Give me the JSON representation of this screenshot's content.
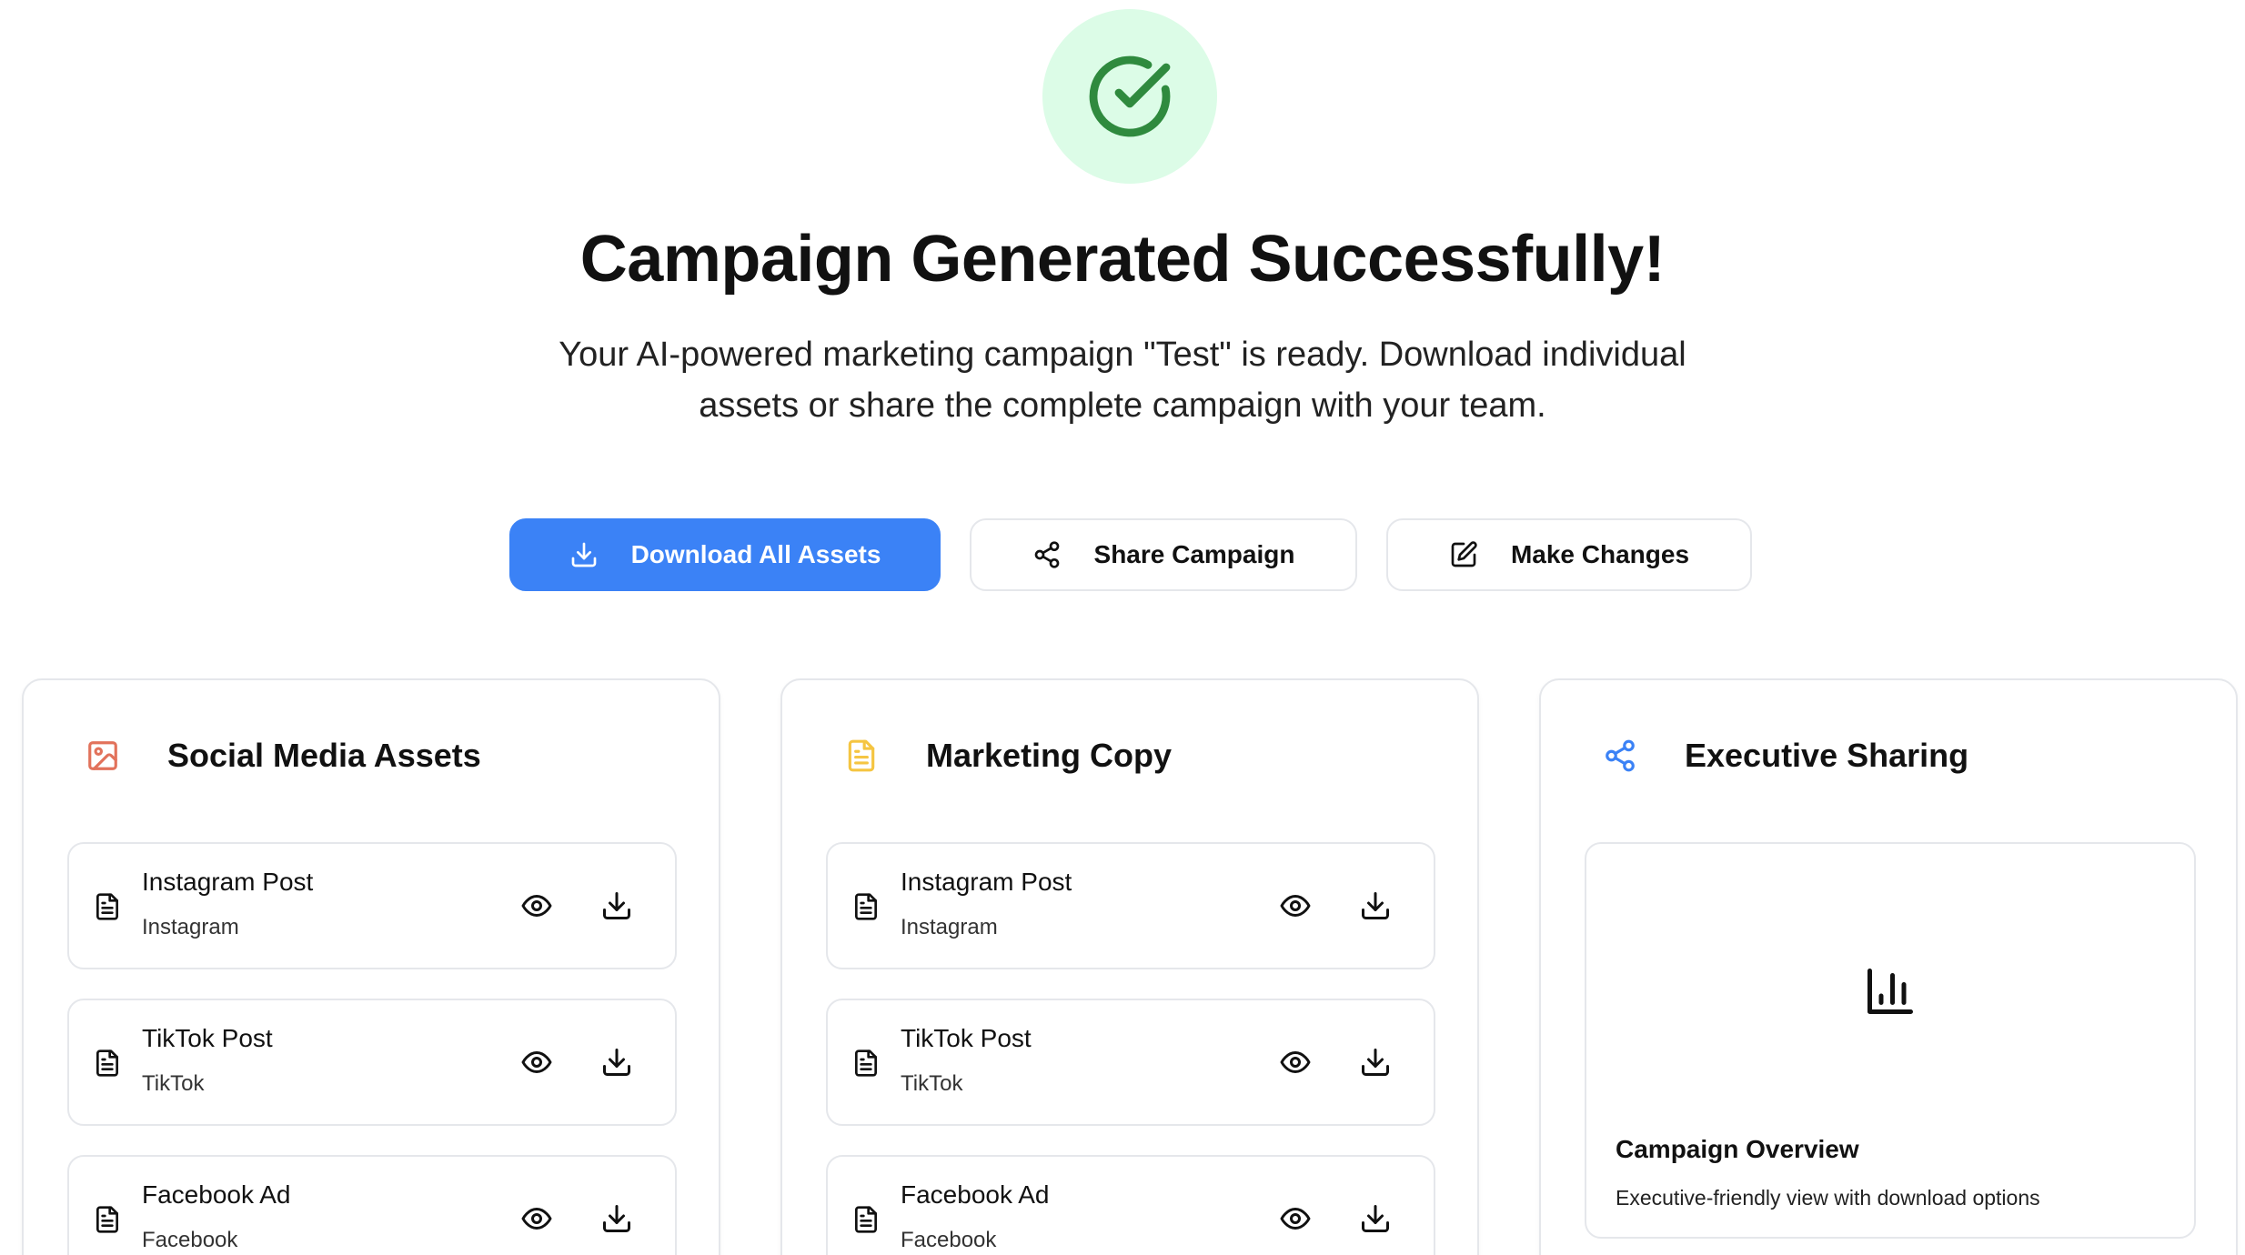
{
  "hero": {
    "icon": "check-circle-icon",
    "title": "Campaign Generated Successfully!",
    "subtitle": "Your AI-powered marketing campaign \"Test\" is ready. Download individual assets or share the complete campaign with your team."
  },
  "actions": {
    "download_all": "Download All Assets",
    "share": "Share Campaign",
    "edit": "Make Changes"
  },
  "colors": {
    "primary": "#3b82f6",
    "success": "#2f8a3e",
    "success_bg": "#dcfce7",
    "social_icon": "#e2725b",
    "copy_icon": "#f5c542",
    "share_icon": "#3b82f6"
  },
  "social_media": {
    "title": "Social Media Assets",
    "icon": "image-icon",
    "items": [
      {
        "name": "Instagram Post",
        "platform": "Instagram"
      },
      {
        "name": "TikTok Post",
        "platform": "TikTok"
      },
      {
        "name": "Facebook Ad",
        "platform": "Facebook"
      }
    ]
  },
  "marketing_copy": {
    "title": "Marketing Copy",
    "icon": "document-icon",
    "items": [
      {
        "name": "Instagram Post",
        "platform": "Instagram"
      },
      {
        "name": "TikTok Post",
        "platform": "TikTok"
      },
      {
        "name": "Facebook Ad",
        "platform": "Facebook"
      }
    ]
  },
  "executive_sharing": {
    "title": "Executive Sharing",
    "icon": "share-icon",
    "overview": {
      "icon": "bar-chart-icon",
      "title": "Campaign Overview",
      "description": "Executive-friendly view with download options"
    }
  }
}
